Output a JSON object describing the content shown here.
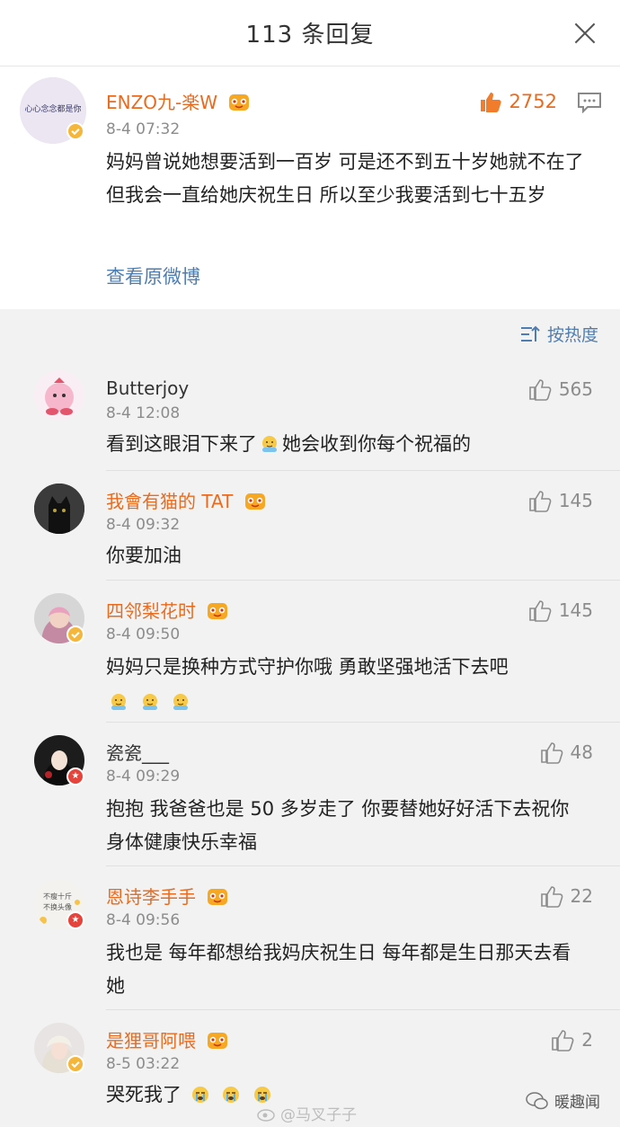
{
  "header": {
    "title": "113 条回复"
  },
  "main": {
    "name": "ENZO九-楽W",
    "time": "8-4 07:32",
    "likes": "2752",
    "avatar_text": "心心念念都是你",
    "content": "妈妈曾说她想要活到一百岁 可是还不到五十岁她就不在了 但我会一直给她庆祝生日 所以至少我要活到七十五岁",
    "view_original": "查看原微博"
  },
  "sort": {
    "label": "按热度"
  },
  "comments": [
    {
      "name": "Butterjoy",
      "time": "8-4 12:08",
      "likes": "565",
      "text_a": "看到这眼泪下来了",
      "text_b": "她会收到你每个祝福的"
    },
    {
      "name": "我會有猫的 TAT",
      "time": "8-4 09:32",
      "likes": "145",
      "text": "你要加油"
    },
    {
      "name": "四邻梨花时",
      "time": "8-4 09:50",
      "likes": "145",
      "text": "妈妈只是换种方式守护你哦 勇敢坚强地活下去吧"
    },
    {
      "name": "瓷瓷___",
      "time": "8-4 09:29",
      "likes": "48",
      "text": "抱抱 我爸爸也是 50 多岁走了 你要替她好好活下去祝你身体健康快乐幸福"
    },
    {
      "name": "恩诗李手手",
      "time": "8-4 09:56",
      "likes": "22",
      "text": "我也是 每年都想给我妈庆祝生日 每年都是生日那天去看她",
      "avatar_text_1": "不瘦十斤",
      "avatar_text_2": "不换头像"
    },
    {
      "name": "是狸哥阿喂",
      "time": "8-5 03:22",
      "likes": "2",
      "text": "哭死我了"
    }
  ],
  "watermark": {
    "left": "@马叉子子",
    "right": "暖趣闻"
  },
  "colors": {
    "accent_orange": "#e96b1f",
    "link_blue": "#507daf",
    "gray_text": "#8c8c8c"
  }
}
